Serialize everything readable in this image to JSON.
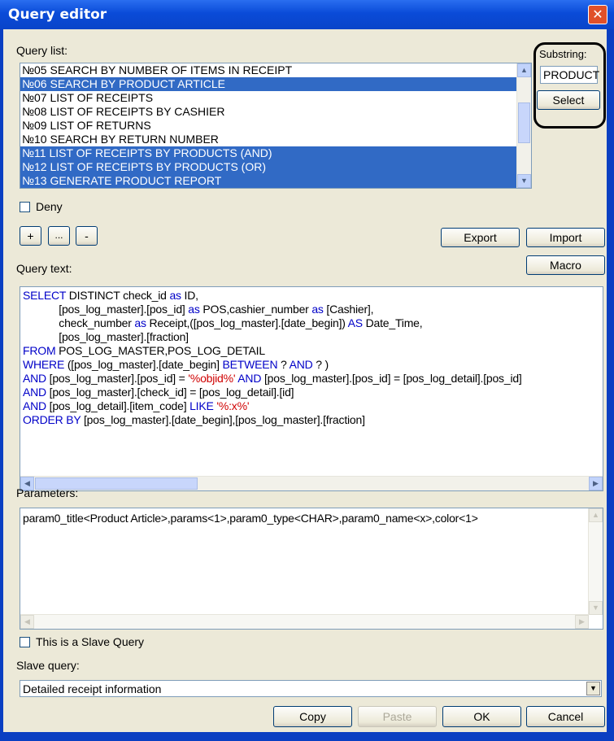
{
  "window": {
    "title": "Query editor",
    "close": "✕"
  },
  "query_list": {
    "label": "Query list:",
    "items": [
      {
        "text": "№05 SEARCH BY NUMBER OF ITEMS IN RECEIPT",
        "selected": false
      },
      {
        "text": "№06 SEARCH BY PRODUCT ARTICLE",
        "selected": true
      },
      {
        "text": "№07 LIST OF RECEIPTS",
        "selected": false
      },
      {
        "text": "№08 LIST OF RECEIPTS BY CASHIER",
        "selected": false
      },
      {
        "text": "№09 LIST OF RETURNS",
        "selected": false
      },
      {
        "text": "№10 SEARCH BY RETURN NUMBER",
        "selected": false
      },
      {
        "text": "№11 LIST OF RECEIPTS BY PRODUCTS (AND)",
        "selected": true
      },
      {
        "text": "№12 LIST OF RECEIPTS BY PRODUCTS (OR)",
        "selected": true
      },
      {
        "text": "№13 GENERATE PRODUCT REPORT",
        "selected": true
      }
    ],
    "scroll_position": 0.45
  },
  "substring": {
    "label": "Substring:",
    "value": "PRODUCT",
    "select_button": "Select"
  },
  "deny": {
    "label": "Deny",
    "checked": false
  },
  "toolbar": {
    "add": "+",
    "edit": "...",
    "remove": "-",
    "export": "Export",
    "import": "Import",
    "macro": "Macro"
  },
  "query_text": {
    "label": "Query text:",
    "lines": [
      [
        [
          "k",
          "SELECT"
        ],
        [
          "t",
          " DISTINCT check_id "
        ],
        [
          "k",
          "as"
        ],
        [
          "t",
          " ID,"
        ]
      ],
      [
        [
          "t",
          "            [pos_log_master].[pos_id] "
        ],
        [
          "k",
          "as"
        ],
        [
          "t",
          " POS,cashier_number "
        ],
        [
          "k",
          "as"
        ],
        [
          "t",
          " [Cashier],"
        ]
      ],
      [
        [
          "t",
          "            check_number "
        ],
        [
          "k",
          "as"
        ],
        [
          "t",
          " Receipt,([pos_log_master].[date_begin]) "
        ],
        [
          "k",
          "AS"
        ],
        [
          "t",
          " Date_Time,"
        ]
      ],
      [
        [
          "t",
          "            [pos_log_master].[fraction]"
        ]
      ],
      [
        [
          "k",
          "FROM"
        ],
        [
          "t",
          " POS_LOG_MASTER,POS_LOG_DETAIL"
        ]
      ],
      [
        [
          "k",
          "WHERE"
        ],
        [
          "t",
          " ([pos_log_master].[date_begin] "
        ],
        [
          "k",
          "BETWEEN"
        ],
        [
          "t",
          " ? "
        ],
        [
          "k",
          "AND"
        ],
        [
          "t",
          " ? )"
        ]
      ],
      [
        [
          "k",
          "AND"
        ],
        [
          "t",
          " [pos_log_master].[pos_id] = "
        ],
        [
          "s",
          "'%objid%'"
        ],
        [
          "t",
          " "
        ],
        [
          "k",
          "AND"
        ],
        [
          "t",
          " [pos_log_master].[pos_id] = [pos_log_detail].[pos_id]"
        ]
      ],
      [
        [
          "k",
          "AND"
        ],
        [
          "t",
          " [pos_log_master].[check_id] = [pos_log_detail].[id]"
        ]
      ],
      [
        [
          "k",
          "AND"
        ],
        [
          "t",
          " [pos_log_detail].[item_code] "
        ],
        [
          "k",
          "LIKE"
        ],
        [
          "t",
          " "
        ],
        [
          "s",
          "'%:x%'"
        ]
      ],
      [
        [
          "k",
          "ORDER BY"
        ],
        [
          "t",
          " [pos_log_master].[date_begin],[pos_log_master].[fraction]"
        ]
      ]
    ]
  },
  "parameters": {
    "label": "Parameters:",
    "value": "param0_title<Product Article>,params<1>,param0_type<CHAR>,param0_name<x>,color<1>"
  },
  "slave": {
    "checkbox_label": "This is a Slave Query",
    "checked": false,
    "query_label": "Slave query:",
    "selected": "Detailed receipt information"
  },
  "bottom_buttons": {
    "copy": "Copy",
    "paste": "Paste",
    "ok": "OK",
    "cancel": "Cancel"
  },
  "icons": {
    "scroll_up": "▲",
    "scroll_down": "▼",
    "scroll_left": "◀",
    "scroll_right": "▶",
    "combo_arrow": "▼"
  }
}
